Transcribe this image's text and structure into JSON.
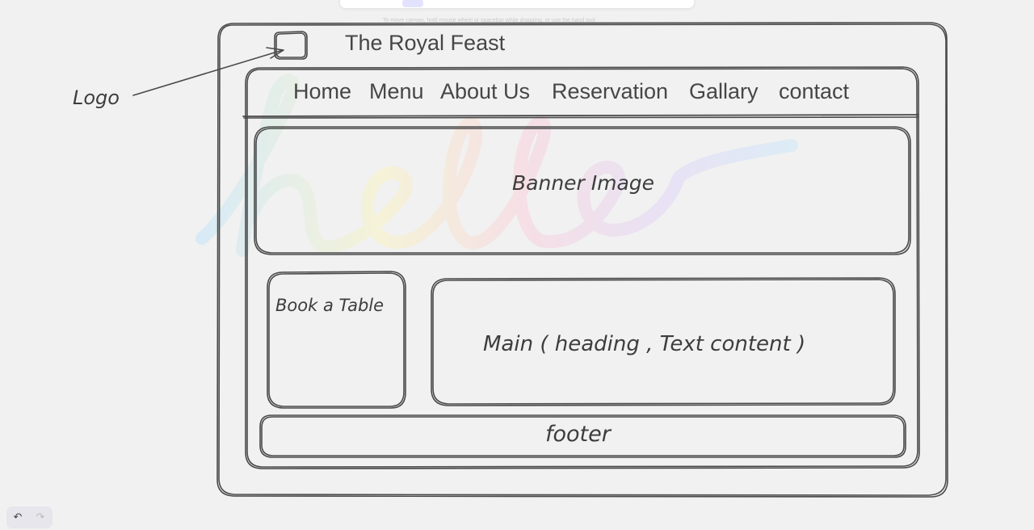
{
  "header": {
    "site_title": "The Royal Feast"
  },
  "nav": {
    "items": [
      "Home",
      "Menu",
      "About Us",
      "Reservation",
      "Gallary",
      "contact"
    ]
  },
  "annotations": {
    "logo": "Logo",
    "banner": "Banner Image",
    "book_table": "Book a Table",
    "main": "Main ( heading , Text content )",
    "footer": "footer"
  },
  "watermark": {
    "text": "hello"
  },
  "toolbar": {
    "undo_icon": "undo-icon",
    "redo_icon": "redo-icon"
  },
  "colors": {
    "background": "#f1f1f1",
    "stroke": "#3d3d3d",
    "toolbar_active": "#e3e2fe"
  }
}
